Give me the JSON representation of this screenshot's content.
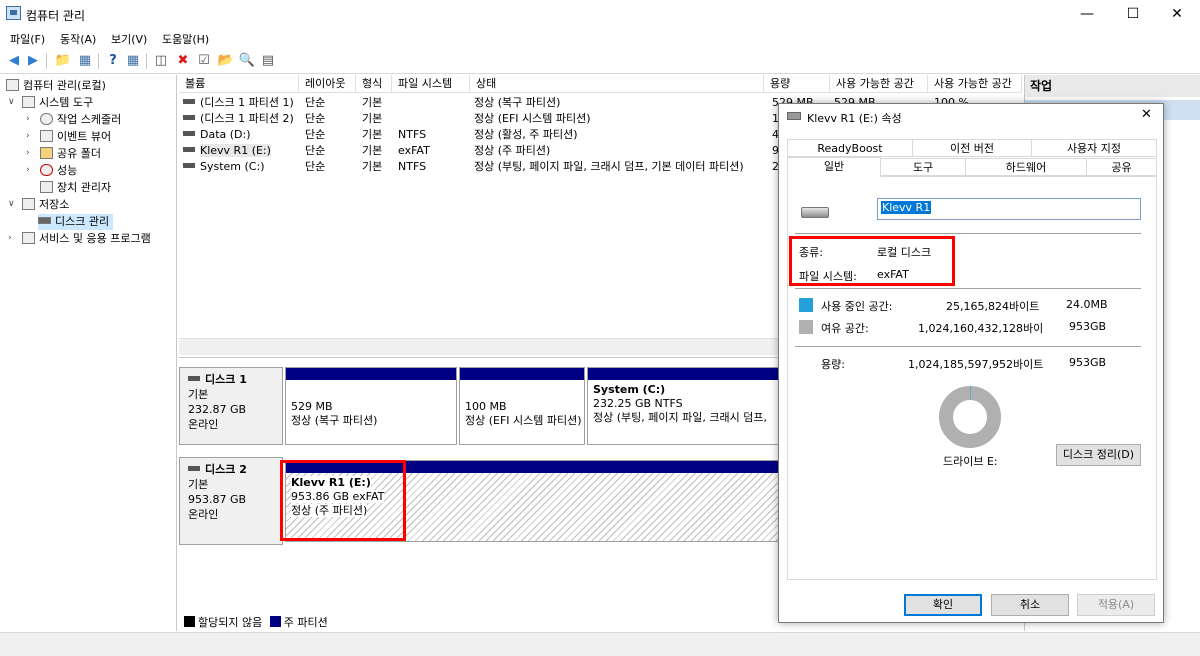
{
  "window": {
    "title": "컴퓨터 관리"
  },
  "menu": [
    "파일(F)",
    "동작(A)",
    "보기(V)",
    "도움말(H)"
  ],
  "tree": {
    "root": "컴퓨터 관리(로컬)",
    "system_tools": "시스템 도구",
    "task_scheduler": "작업 스케줄러",
    "event_viewer": "이벤트 뷰어",
    "shared_folders": "공유 폴더",
    "performance": "성능",
    "device_manager": "장치 관리자",
    "storage": "저장소",
    "disk_management": "디스크 관리",
    "services": "서비스 및 응용 프로그램"
  },
  "list": {
    "columns": [
      "볼륨",
      "레이아웃",
      "형식",
      "파일 시스템",
      "상태",
      "용량",
      "사용 가능한 공간",
      "사용 가능한 공간"
    ],
    "rows": [
      {
        "volume": "(디스크 1 파티션 1)",
        "layout": "단순",
        "type": "기본",
        "fs": "",
        "status": "정상 (복구 파티션)",
        "capacity": "529 MB",
        "free": "529 MB",
        "pct": "100 %"
      },
      {
        "volume": "(디스크 1 파티션 2)",
        "layout": "단순",
        "type": "기본",
        "fs": "",
        "status": "정상 (EFI 시스템 파티션)",
        "capacity": "1",
        "free": "",
        "pct": ""
      },
      {
        "volume": "Data (D:)",
        "layout": "단순",
        "type": "기본",
        "fs": "NTFS",
        "status": "정상 (활성, 주 파티션)",
        "capacity": "4",
        "free": "",
        "pct": ""
      },
      {
        "volume": "Klevv R1 (E:)",
        "layout": "단순",
        "type": "기본",
        "fs": "exFAT",
        "status": "정상 (주 파티션)",
        "capacity": "9",
        "free": "",
        "pct": ""
      },
      {
        "volume": "System (C:)",
        "layout": "단순",
        "type": "기본",
        "fs": "NTFS",
        "status": "정상 (부팅, 페이지 파일, 크래시 덤프, 기본 데이터 파티션)",
        "capacity": "2",
        "free": "",
        "pct": ""
      }
    ]
  },
  "disks": [
    {
      "name": "디스크 1",
      "kind": "기본",
      "size": "232.87 GB",
      "state": "온라인",
      "partitions": [
        {
          "title": "",
          "size": "529 MB",
          "status": "정상 (복구 파티션)"
        },
        {
          "title": "",
          "size": "100 MB",
          "status": "정상 (EFI 시스템 파티션)"
        },
        {
          "title": "System  (C:)",
          "size": "232.25 GB NTFS",
          "status": "정상 (부팅, 페이지 파일, 크래시 덤프,"
        }
      ]
    },
    {
      "name": "디스크 2",
      "kind": "기본",
      "size": "953.87 GB",
      "state": "온라인",
      "partitions": [
        {
          "title": "Klevv R1  (E:)",
          "size": "953.86 GB exFAT",
          "status": "정상 (주 파티션)"
        }
      ]
    }
  ],
  "legend": {
    "unallocated": "할당되지 않음",
    "primary": "주 파티션"
  },
  "actions": {
    "header": "작업"
  },
  "dialog": {
    "title": "Klevv R1 (E:) 속성",
    "tabs_top": [
      "ReadyBoost",
      "이전 버전",
      "사용자 지정"
    ],
    "tabs_bottom": [
      "일반",
      "도구",
      "하드웨어",
      "공유"
    ],
    "volume_name": "Klevv R1",
    "type_label": "종류:",
    "type_value": "로컬 디스크",
    "fs_label": "파일 시스템:",
    "fs_value": "exFAT",
    "used_label": "사용 중인 공간:",
    "used_bytes": "25,165,824바이트",
    "used_size": "24.0MB",
    "free_label": "여유 공간:",
    "free_bytes": "1,024,160,432,128바이",
    "free_size": "953GB",
    "cap_label": "용량:",
    "cap_bytes": "1,024,185,597,952바이트",
    "cap_size": "953GB",
    "drive_label": "드라이브 E:",
    "cleanup_button": "디스크 정리(D)",
    "ok": "확인",
    "cancel": "취소",
    "apply": "적용(A)",
    "used_fraction": 2.46e-05
  },
  "colors": {
    "used": "#26a0da",
    "free": "#b0b0b0",
    "partition_bar": "#000084",
    "highlight": "#ff0000"
  }
}
